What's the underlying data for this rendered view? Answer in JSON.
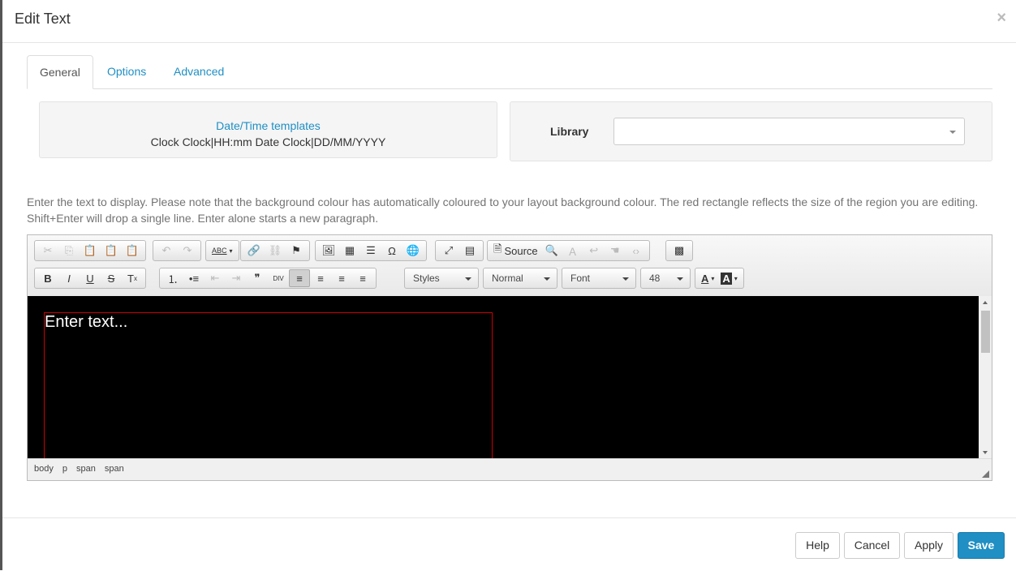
{
  "dialog": {
    "title": "Edit Text",
    "close_glyph": "×"
  },
  "tabs": [
    {
      "label": "General",
      "active": true
    },
    {
      "label": "Options",
      "active": false
    },
    {
      "label": "Advanced",
      "active": false
    }
  ],
  "datetime": {
    "title": "Date/Time templates",
    "items": "Clock Clock|HH:mm Date Clock|DD/MM/YYYY"
  },
  "library": {
    "label": "Library",
    "value": ""
  },
  "help_text": "Enter the text to display. Please note that the background colour has automatically coloured to your layout background colour. The red rectangle reflects the size of the region you are editing. Shift+Enter will drop a single line. Enter alone starts a new paragraph.",
  "toolbar": {
    "source_label": "Source",
    "styles_label": "Styles",
    "format_label": "Normal",
    "font_label": "Font",
    "size_label": "48"
  },
  "editor": {
    "placeholder": "Enter text...",
    "background": "#000000",
    "region_border": "#cc0000"
  },
  "status_path": [
    "body",
    "p",
    "span",
    "span"
  ],
  "buttons": {
    "help": "Help",
    "cancel": "Cancel",
    "apply": "Apply",
    "save": "Save"
  },
  "colors": {
    "accent": "#1f8fc4"
  }
}
